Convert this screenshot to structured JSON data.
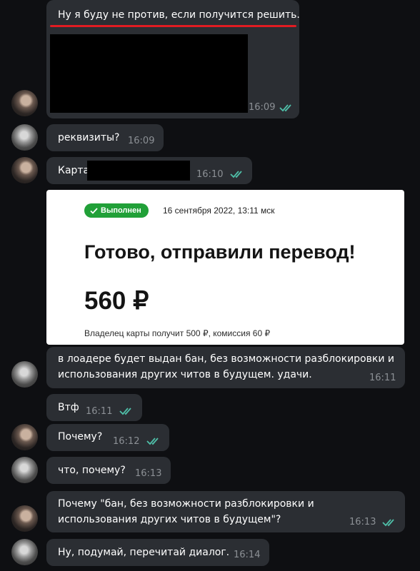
{
  "colors": {
    "background": "#0e0f12",
    "bubble": "#2b2e33",
    "read_ticks": "#4fbfa8",
    "highlight": "#e11b22",
    "badge": "#21a038"
  },
  "messages": [
    {
      "text": "Ну я буду не против, если получится решить.",
      "time": "16:09",
      "read": true
    },
    {
      "text": "реквизиты?",
      "time": "16:09"
    },
    {
      "text": "Карта",
      "time": "16:10",
      "read": true
    },
    {
      "line1": "в лоадере будет выдан бан, без возможности разблокировки и",
      "line2": "использования других читов в будущем. удачи.",
      "time": "16:11"
    },
    {
      "text": "Втф",
      "time": "16:11",
      "read": true
    },
    {
      "text": "Почему?",
      "time": "16:12",
      "read": true
    },
    {
      "text": "что, почему?",
      "time": "16:13"
    },
    {
      "line1": "Почему \"бан, без возможности разблокировки и",
      "line2": "использования других читов в будущем\"?",
      "time": "16:13",
      "read": true
    },
    {
      "text": "Ну, подумай, перечитай диалог.",
      "time": "16:14"
    }
  ],
  "receipt": {
    "status": "Выполнен",
    "date": "16 сентября 2022, 13:11 мск",
    "title": "Готово, отправили перевод!",
    "amount": "560 ₽",
    "note": "Владелец карты получит 500 ₽, комиссия 60 ₽"
  },
  "icons": {
    "read_receipt": "double-check-icon",
    "status_check": "check-icon"
  }
}
